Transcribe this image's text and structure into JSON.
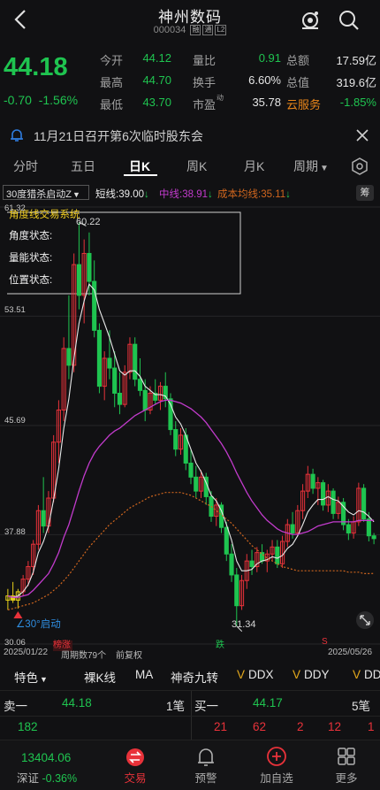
{
  "header": {
    "title": "神州数码",
    "code": "000034",
    "badges": [
      "融",
      "通",
      "L2"
    ]
  },
  "quote": {
    "price": "44.18",
    "change": "-0.70",
    "change_pct": "-1.56%",
    "rows": [
      [
        {
          "l": "今开",
          "v": "44.12"
        },
        {
          "l": "量比",
          "v": "0.91"
        },
        {
          "l": "总额",
          "v": "17.59亿"
        }
      ],
      [
        {
          "l": "最高",
          "v": "44.70"
        },
        {
          "l": "换手",
          "v": "6.60%"
        },
        {
          "l": "总值",
          "v": "319.6亿"
        }
      ],
      [
        {
          "l": "最低",
          "v": "43.70"
        },
        {
          "l": "市盈",
          "sup": "动",
          "v": "35.78"
        },
        {
          "l": "云服务",
          "v": "-1.85%"
        }
      ]
    ]
  },
  "notice": {
    "text": "11月21日召开第6次临时股东会"
  },
  "tabs": [
    "分时",
    "五日",
    "日K",
    "周K",
    "月K",
    "周期"
  ],
  "indicators": {
    "name": "30度猎杀启动Z",
    "short_label": "短线:",
    "short_val": "39.00",
    "mid_label": "中线:",
    "mid_val": "38.91",
    "cost_label": "成本均线:",
    "cost_val": "35.11",
    "badge": "筹"
  },
  "chart": {
    "system_title": "角度线交易系统",
    "status": [
      "角度状态:",
      "量能状态:",
      "位置状态:"
    ],
    "y_ticks": [
      "61.32",
      "53.51",
      "45.69",
      "37.88",
      "30.06"
    ],
    "high_label": "60.22",
    "low_label": "31.34",
    "start_label": "∠30°启动",
    "bottom_tags": [
      "榜涨",
      "跌",
      "S"
    ],
    "date_start": "2025/01/22",
    "period_count": "周期数79个",
    "fq": "前复权",
    "date_end": "2025/05/26",
    "colors": {
      "up": "#e8323a",
      "down": "#1fc450",
      "short": "#e8e8e8",
      "mid": "#c23bcc",
      "cost": "#d0661e"
    }
  },
  "chart_data": {
    "type": "candlestick",
    "ylim": [
      30.06,
      61.32
    ],
    "y_ticks": [
      61.32,
      53.51,
      45.69,
      37.88,
      30.06
    ],
    "x_range": [
      "2025/01/22",
      "2025/05/26"
    ],
    "periods": 79,
    "candles_ohlc": [
      [
        33.2,
        34.0,
        32.5,
        33.5
      ],
      [
        33.5,
        34.5,
        33.0,
        33.2
      ],
      [
        33.2,
        34.0,
        32.6,
        33.8
      ],
      [
        33.8,
        35.0,
        33.5,
        34.7
      ],
      [
        34.7,
        36.0,
        34.2,
        35.6
      ],
      [
        35.6,
        37.5,
        35.0,
        37.2
      ],
      [
        37.2,
        40.0,
        36.8,
        39.6
      ],
      [
        39.6,
        42.0,
        38.0,
        38.5
      ],
      [
        38.5,
        41.0,
        38.0,
        40.5
      ],
      [
        40.5,
        45.0,
        40.2,
        44.5
      ],
      [
        44.5,
        47.5,
        43.0,
        46.8
      ],
      [
        46.8,
        52.0,
        46.0,
        51.2
      ],
      [
        51.2,
        55.0,
        49.0,
        50.0
      ],
      [
        50.0,
        58.0,
        49.5,
        57.2
      ],
      [
        57.2,
        60.22,
        54.0,
        55.0
      ],
      [
        55.0,
        59.0,
        53.0,
        58.0
      ],
      [
        58.0,
        59.5,
        55.0,
        56.0
      ],
      [
        56.0,
        57.5,
        52.0,
        52.5
      ],
      [
        52.5,
        53.0,
        48.0,
        48.5
      ],
      [
        48.5,
        51.0,
        47.5,
        50.5
      ],
      [
        50.5,
        52.5,
        49.0,
        49.8
      ],
      [
        49.8,
        51.0,
        47.0,
        48.0
      ],
      [
        48.0,
        49.5,
        46.5,
        47.2
      ],
      [
        47.2,
        50.0,
        47.0,
        49.5
      ],
      [
        49.5,
        52.0,
        49.0,
        51.5
      ],
      [
        51.5,
        52.0,
        48.5,
        49.0
      ],
      [
        49.0,
        50.5,
        47.8,
        48.2
      ],
      [
        48.2,
        49.0,
        46.0,
        46.8
      ],
      [
        46.8,
        48.5,
        46.5,
        48.0
      ],
      [
        48.0,
        49.0,
        47.2,
        47.5
      ],
      [
        47.5,
        48.8,
        46.8,
        48.5
      ],
      [
        48.5,
        49.5,
        47.0,
        47.6
      ],
      [
        47.6,
        48.0,
        45.0,
        45.4
      ],
      [
        45.4,
        46.0,
        43.5,
        44.0
      ],
      [
        44.0,
        45.5,
        43.6,
        45.0
      ],
      [
        45.0,
        45.5,
        42.5,
        43.0
      ],
      [
        43.0,
        44.0,
        41.5,
        42.0
      ],
      [
        42.0,
        42.8,
        40.5,
        41.0
      ],
      [
        41.0,
        42.5,
        40.5,
        42.0
      ],
      [
        42.0,
        42.3,
        40.0,
        40.6
      ],
      [
        40.6,
        41.0,
        38.8,
        39.2
      ],
      [
        39.2,
        40.5,
        38.5,
        40.0
      ],
      [
        40.0,
        40.2,
        38.0,
        38.4
      ],
      [
        38.4,
        38.8,
        36.0,
        36.5
      ],
      [
        36.5,
        37.2,
        34.5,
        35.0
      ],
      [
        35.0,
        35.5,
        31.34,
        32.8
      ],
      [
        32.8,
        35.0,
        32.5,
        34.6
      ],
      [
        34.6,
        36.5,
        34.0,
        36.0
      ],
      [
        36.0,
        36.8,
        35.0,
        35.6
      ],
      [
        35.6,
        37.0,
        35.2,
        36.6
      ],
      [
        36.6,
        37.2,
        35.8,
        36.0
      ],
      [
        36.0,
        36.8,
        35.2,
        36.5
      ],
      [
        36.5,
        37.5,
        36.0,
        37.0
      ],
      [
        37.0,
        37.5,
        35.5,
        35.8
      ],
      [
        35.8,
        37.8,
        35.5,
        37.4
      ],
      [
        37.4,
        39.0,
        37.0,
        38.6
      ],
      [
        38.6,
        39.5,
        37.6,
        38.0
      ],
      [
        38.0,
        40.0,
        37.8,
        39.6
      ],
      [
        39.6,
        41.5,
        39.0,
        41.0
      ],
      [
        41.0,
        42.8,
        40.5,
        42.2
      ],
      [
        42.2,
        42.6,
        40.8,
        41.2
      ],
      [
        41.2,
        42.0,
        40.0,
        41.6
      ],
      [
        41.6,
        41.8,
        39.6,
        40.0
      ],
      [
        40.0,
        41.5,
        39.5,
        41.0
      ],
      [
        41.0,
        41.2,
        39.0,
        39.4
      ],
      [
        39.4,
        40.6,
        39.0,
        40.2
      ],
      [
        40.2,
        40.5,
        38.2,
        38.6
      ],
      [
        38.6,
        39.0,
        37.5,
        38.0
      ],
      [
        38.0,
        39.2,
        37.6,
        38.8
      ],
      [
        38.8,
        41.6,
        38.5,
        41.2
      ],
      [
        41.2,
        41.5,
        38.8,
        39.0
      ],
      [
        39.0,
        39.5,
        37.4,
        37.8
      ],
      [
        37.8,
        38.0,
        37.2,
        37.6
      ]
    ],
    "series": [
      {
        "name": "短线",
        "values": [
          33.5,
          33.4,
          33.5,
          33.8,
          34.3,
          35.2,
          36.6,
          37.4,
          38.5,
          40.4,
          42.6,
          45.5,
          47.6,
          50.5,
          53.0,
          54.6,
          55.8,
          55.4,
          54.0,
          53.0,
          52.0,
          50.8,
          49.6,
          49.3,
          49.6,
          49.6,
          49.2,
          48.5,
          48.2,
          47.9,
          47.9,
          47.8,
          47.2,
          46.3,
          45.8,
          45.0,
          44.0,
          43.0,
          42.4,
          41.6,
          40.7,
          40.3,
          39.6,
          38.6,
          37.5,
          36.0,
          35.3,
          35.3,
          35.4,
          35.8,
          36.0,
          36.1,
          36.3,
          36.2,
          36.4,
          36.9,
          37.2,
          37.8,
          38.6,
          39.5,
          40.0,
          40.4,
          40.4,
          40.6,
          40.4,
          40.3,
          39.9,
          39.5,
          39.3,
          39.6,
          39.5,
          39.2,
          38.8
        ]
      },
      {
        "name": "中线",
        "values": [
          33.5,
          33.4,
          33.4,
          33.5,
          33.6,
          33.9,
          34.3,
          34.7,
          35.1,
          35.8,
          36.6,
          37.7,
          38.6,
          39.8,
          41.0,
          42.1,
          43.0,
          43.7,
          44.2,
          44.6,
          45.0,
          45.3,
          45.5,
          45.8,
          46.1,
          46.4,
          46.6,
          46.8,
          47.0,
          47.2,
          47.4,
          47.5,
          47.5,
          47.4,
          47.3,
          47.1,
          46.9,
          46.6,
          46.3,
          45.9,
          45.4,
          44.9,
          44.4,
          43.8,
          43.1,
          42.3,
          41.6,
          40.9,
          40.3,
          39.8,
          39.3,
          38.9,
          38.6,
          38.3,
          38.1,
          38.0,
          37.9,
          37.9,
          38.0,
          38.1,
          38.3,
          38.5,
          38.6,
          38.7,
          38.8,
          38.8,
          38.8,
          38.8,
          38.8,
          38.9,
          38.9,
          38.9,
          38.91
        ]
      },
      {
        "name": "成本均线",
        "values": [
          32.5,
          32.6,
          32.7,
          32.8,
          32.9,
          33.0,
          33.2,
          33.4,
          33.6,
          33.9,
          34.2,
          34.6,
          35.0,
          35.5,
          36.0,
          36.5,
          37.0,
          37.4,
          37.8,
          38.2,
          38.6,
          38.9,
          39.2,
          39.5,
          39.8,
          40.0,
          40.2,
          40.4,
          40.6,
          40.7,
          40.8,
          40.9,
          40.9,
          40.9,
          40.9,
          40.8,
          40.7,
          40.5,
          40.3,
          40.1,
          39.9,
          39.6,
          39.3,
          39.0,
          38.7,
          38.3,
          37.9,
          37.5,
          37.1,
          36.8,
          36.5,
          36.2,
          36.0,
          35.8,
          35.6,
          35.5,
          35.4,
          35.3,
          35.3,
          35.3,
          35.3,
          35.3,
          35.3,
          35.3,
          35.3,
          35.3,
          35.3,
          35.2,
          35.2,
          35.2,
          35.1,
          35.1,
          35.11
        ]
      }
    ]
  },
  "tools": [
    {
      "label": "特色",
      "arrow": true
    },
    {
      "label": "裸K线"
    },
    {
      "label": "MA"
    },
    {
      "label": "神奇九转"
    },
    {
      "label": "DDX",
      "v": true
    },
    {
      "label": "DDY",
      "v": true
    },
    {
      "label": "DD",
      "v": true
    }
  ],
  "orderbook": {
    "sell_label": "卖一",
    "sell_price": "44.18",
    "sell_count": "1笔",
    "buy_label": "买一",
    "buy_price": "44.17",
    "buy_count": "5笔",
    "sell_vols": [
      "182"
    ],
    "buy_vols": [
      "21",
      "62",
      "2",
      "12",
      "1"
    ]
  },
  "nav": {
    "index_value": "13404.06",
    "index_name": "深证",
    "index_change": "-0.36%",
    "items": [
      "交易",
      "预警",
      "加自选",
      "更多"
    ]
  }
}
